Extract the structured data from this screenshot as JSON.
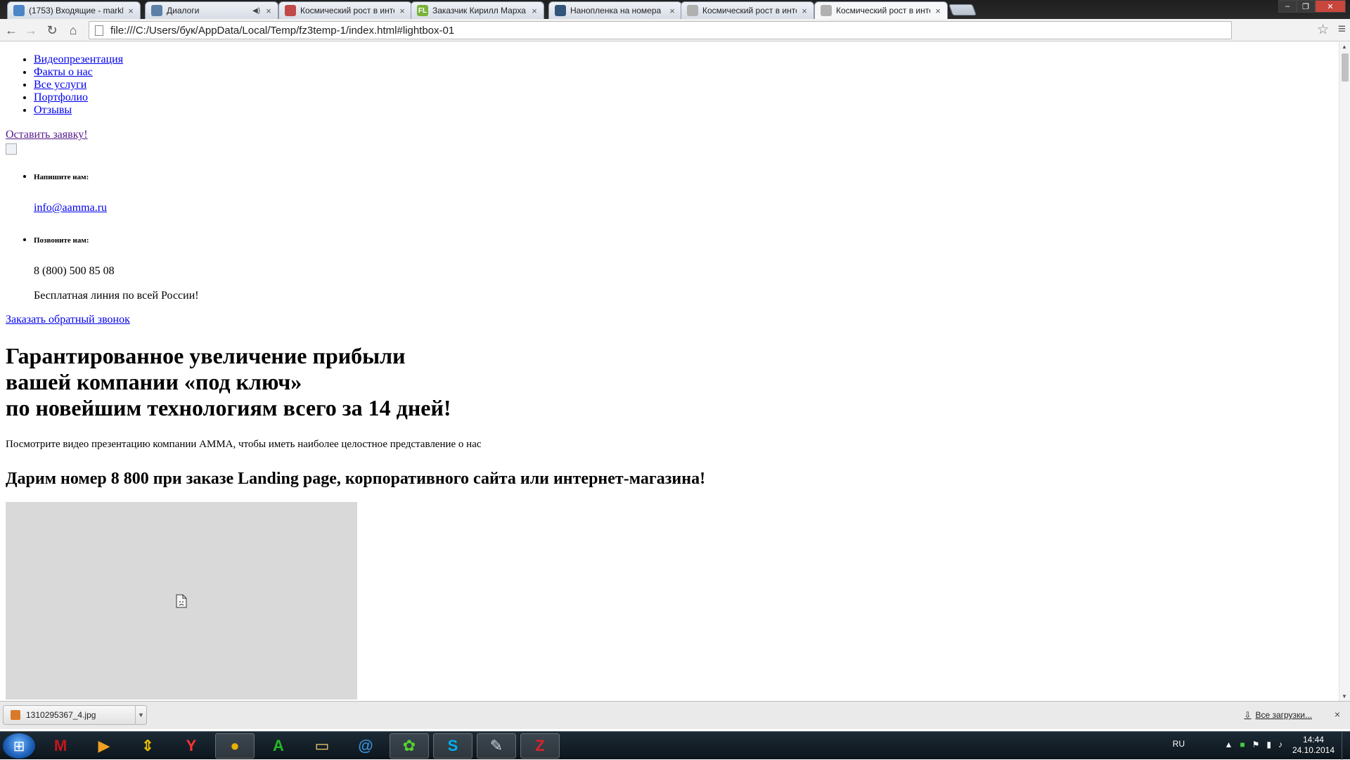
{
  "browser": {
    "tabs": [
      {
        "title": "(1753) Входящие - markh",
        "favicon": "mail-icon",
        "color": "#4b86c5"
      },
      {
        "title": "Диалоги",
        "favicon": "dialogs-icon",
        "color": "#5b7fa6",
        "audio": "◀)"
      },
      {
        "title": "Космический рост в инте",
        "favicon": "rocket-icon",
        "color": "#c04a4a"
      },
      {
        "title": "Заказчик Кирилл Марха",
        "favicon": "fl-icon",
        "color": "#7ab33a",
        "badge": "FL"
      },
      {
        "title": "Нанопленка на номера",
        "favicon": "car-icon",
        "color": "#33557a"
      },
      {
        "title": "Космический рост в инте",
        "favicon": "page-icon",
        "color": "#b0b0b0"
      },
      {
        "title": "Космический рост в инте",
        "favicon": "page-icon",
        "color": "#b0b0b0",
        "active": true
      }
    ],
    "close_glyph": "×",
    "url": "file:///C:/Users/бук/AppData/Local/Temp/fz3temp-1/index.html#lightbox-01"
  },
  "page": {
    "nav": [
      "Видеопрезентация",
      "Факты о нас",
      "Все услуги",
      "Портфолио",
      "Отзывы"
    ],
    "request_link": "Оставить заявку!",
    "contacts": {
      "write_label": "Напишите нам:",
      "email": "info@aamma.ru",
      "call_label": "Позвоните нам:",
      "phone": "8 (800) 500 85 08",
      "free_line": "Бесплатная линия по всей России!"
    },
    "callback_link": "Заказать обратный звонок",
    "hero_line1": "Гарантированное увеличение прибыли",
    "hero_line2": "вашей компании «под ключ»",
    "hero_line3": "по новейшим технологиям всего за 14 дней!",
    "video_text": "Посмотрите видео презентацию компании АММА, чтобы иметь наиболее целостное представление о нас",
    "gift_heading": "Дарим номер 8 800 при заказе Landing page, корпоративного сайта или интернет-магазина!"
  },
  "download_shelf": {
    "file_name": "1310295367_4.jpg",
    "all_downloads": "Все загрузки...",
    "close_glyph": "×"
  },
  "taskbar": {
    "apps": [
      {
        "name": "mcafee-icon",
        "glyph": "M",
        "color": "#c4161c"
      },
      {
        "name": "media-player-icon",
        "glyph": "▶",
        "color": "#f0a020"
      },
      {
        "name": "updater-icon",
        "glyph": "⇕",
        "color": "#f5c400"
      },
      {
        "name": "yandex-browser-icon",
        "glyph": "Y",
        "color": "#ff3333"
      },
      {
        "name": "chrome-icon",
        "glyph": "●",
        "color": "#e8b000",
        "open": true
      },
      {
        "name": "antivirus-a-icon",
        "glyph": "A",
        "color": "#22bb22"
      },
      {
        "name": "file-explorer-icon",
        "glyph": "▭",
        "color": "#f2d06b"
      },
      {
        "name": "mail-agent-icon",
        "glyph": "@",
        "color": "#3a8fd9"
      },
      {
        "name": "icq-icon",
        "glyph": "✿",
        "color": "#55d430",
        "open": true
      },
      {
        "name": "skype-icon",
        "glyph": "S",
        "color": "#00aff0",
        "open": true
      },
      {
        "name": "paint-icon",
        "glyph": "✎",
        "color": "#cfd8e0",
        "open": true
      },
      {
        "name": "filezilla-icon",
        "glyph": "Z",
        "color": "#d8232a",
        "open": true
      }
    ],
    "language": "RU",
    "time": "14:44",
    "date": "24.10.2014"
  }
}
